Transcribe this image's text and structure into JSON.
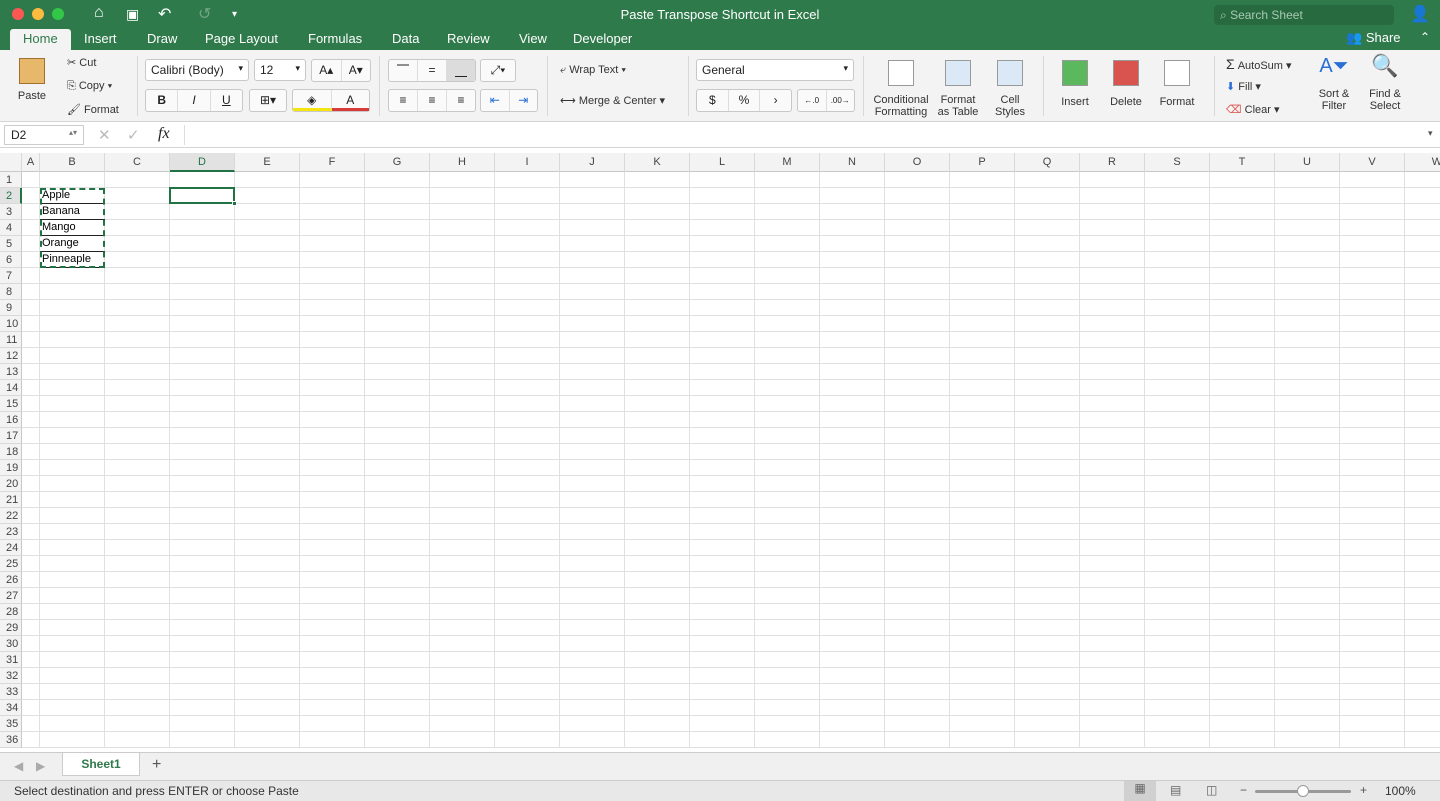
{
  "window": {
    "title": "Paste Transpose Shortcut in Excel",
    "search_placeholder": "Search Sheet",
    "share": "Share"
  },
  "tabs": [
    "Home",
    "Insert",
    "Draw",
    "Page Layout",
    "Formulas",
    "Data",
    "Review",
    "View",
    "Developer"
  ],
  "ribbon": {
    "paste": "Paste",
    "cut": "Cut",
    "copy": "Copy",
    "format_painter": "Format",
    "font": "Calibri (Body)",
    "font_size": "12",
    "bold": "B",
    "italic": "I",
    "underline": "U",
    "wrap_text": "Wrap Text",
    "merge_center": "Merge & Center",
    "number_format": "General",
    "currency": "$",
    "percent": "%",
    "comma": "›",
    "conditional_formatting": [
      "Conditional",
      "Formatting"
    ],
    "format_as_table": [
      "Format",
      "as Table"
    ],
    "cell_styles": [
      "Cell",
      "Styles"
    ],
    "insert": "Insert",
    "delete": "Delete",
    "format": "Format",
    "autosum": "AutoSum",
    "fill": "Fill",
    "clear": "Clear",
    "sort_filter": [
      "Sort &",
      "Filter"
    ],
    "find_select": [
      "Find &",
      "Select"
    ]
  },
  "formula_bar": {
    "name_box": "D2",
    "fx": "fx",
    "value": ""
  },
  "grid": {
    "columns": [
      "A",
      "B",
      "C",
      "D",
      "E",
      "F",
      "G",
      "H",
      "I",
      "J",
      "K",
      "L",
      "M",
      "N",
      "O",
      "P",
      "Q",
      "R",
      "S",
      "T",
      "U",
      "V",
      "W"
    ],
    "rows": [
      "1",
      "2",
      "3",
      "4",
      "5",
      "6",
      "7",
      "8",
      "9",
      "10",
      "11",
      "12",
      "13",
      "14",
      "15",
      "16",
      "17",
      "18",
      "19",
      "20",
      "21",
      "22",
      "23",
      "24",
      "25",
      "26",
      "27",
      "28",
      "29",
      "30",
      "31",
      "32",
      "33",
      "34",
      "35",
      "36"
    ],
    "active_cell": "D2",
    "cells": [
      {
        "ref": "B2",
        "value": "Apple"
      },
      {
        "ref": "B3",
        "value": "Banana"
      },
      {
        "ref": "B4",
        "value": "Mango"
      },
      {
        "ref": "B5",
        "value": "Orange"
      },
      {
        "ref": "B6",
        "value": "Pinneaple"
      }
    ],
    "copy_range": "B2:B6"
  },
  "sheets": [
    "Sheet1"
  ],
  "status": {
    "message": "Select destination and press ENTER or choose Paste",
    "zoom": "100%"
  },
  "colors": {
    "accent": "#2f7a4b",
    "selection": "#217346"
  }
}
